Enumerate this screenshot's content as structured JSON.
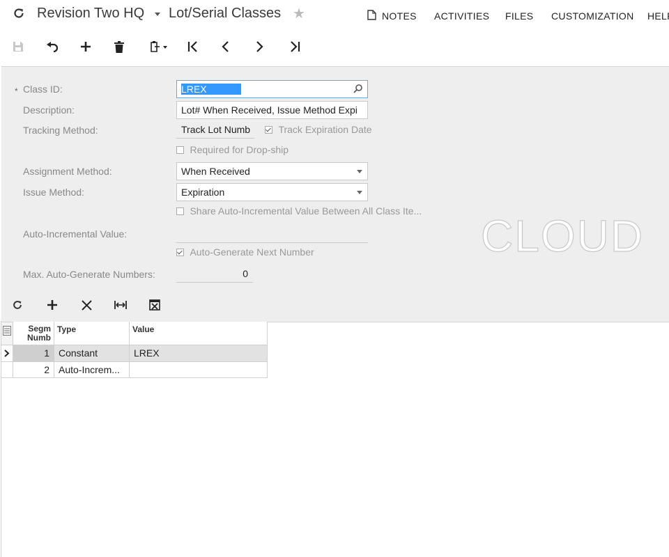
{
  "header": {
    "company": "Revision Two HQ",
    "screen_title": "Lot/Serial Classes",
    "nav": [
      "NOTES",
      "ACTIVITIES",
      "FILES",
      "CUSTOMIZATION",
      "HELP"
    ]
  },
  "form": {
    "required_marker": "*",
    "class_id_label": "Class ID:",
    "class_id_value": "LREX",
    "description_label": "Description:",
    "description_value": "Lot# When Received, Issue Method Expi",
    "tracking_method_label": "Tracking Method:",
    "tracking_method_value": "Track Lot Numb",
    "track_expiration_label": "Track Expiration Date",
    "track_expiration_checked": true,
    "required_dropship_label": "Required for Drop-ship",
    "required_dropship_checked": false,
    "assignment_method_label": "Assignment Method:",
    "assignment_method_value": "When Received",
    "issue_method_label": "Issue Method:",
    "issue_method_value": "Expiration",
    "share_autoinc_label": "Share Auto-Incremental Value Between All Class Ite...",
    "share_autoinc_checked": false,
    "autoinc_value_label": "Auto-Incremental Value:",
    "autoinc_value": "",
    "autogen_label": "Auto-Generate Next Number",
    "autogen_checked": true,
    "max_autogen_label": "Max. Auto-Generate Numbers:",
    "max_autogen_value": "0"
  },
  "watermark": {
    "text": "CLOUD"
  },
  "grid": {
    "columns": {
      "segment_line1": "Segm",
      "segment_line2": "Numb",
      "type": "Type",
      "value": "Value"
    },
    "rows": [
      {
        "segment": "1",
        "type": "Constant",
        "value": "LREX"
      },
      {
        "segment": "2",
        "type": "Auto-Increm...",
        "value": ""
      }
    ]
  },
  "colors": {
    "form_bg": "#eeeeee",
    "selection": "#3399ff",
    "active_row": "#e2e2e2"
  }
}
